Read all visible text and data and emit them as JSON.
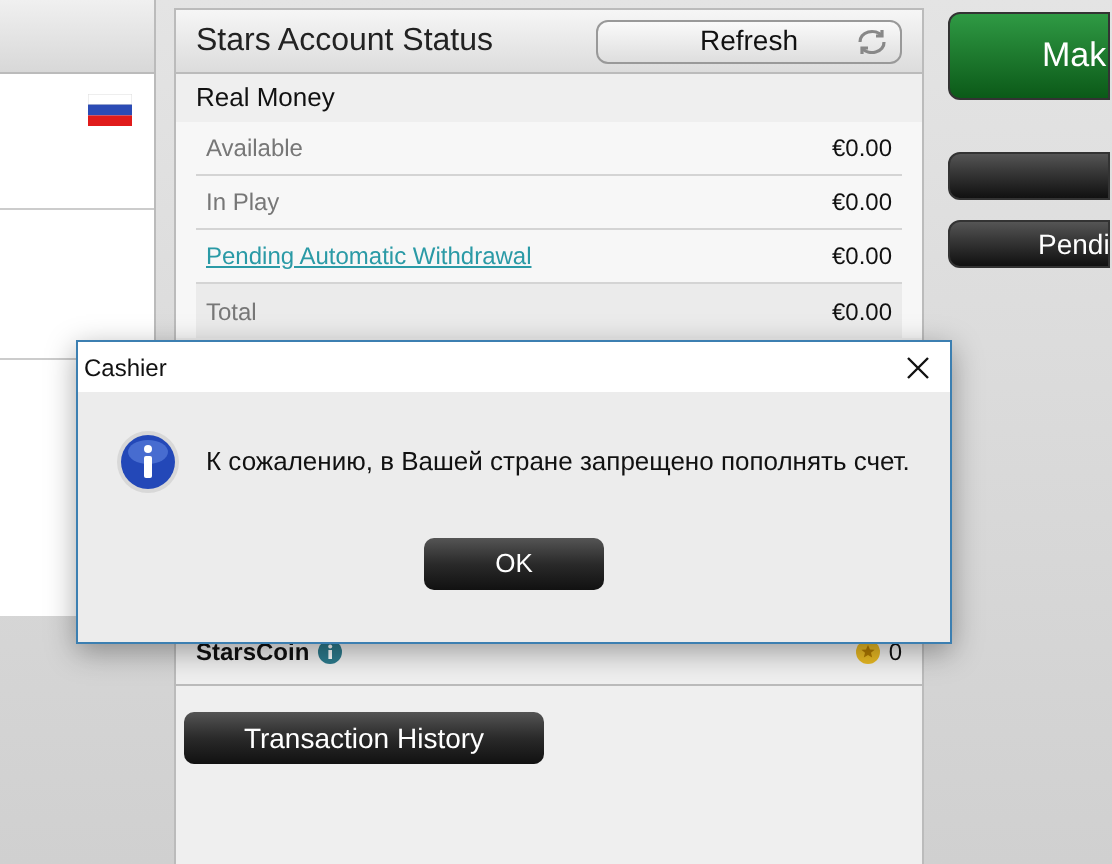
{
  "account_status": {
    "title": "Stars Account Status",
    "refresh_button": "Refresh",
    "section": "Real Money",
    "rows": [
      {
        "label": "Available",
        "value": "€0.00",
        "kind": "plain"
      },
      {
        "label": "In Play",
        "value": "€0.00",
        "kind": "plain"
      },
      {
        "label": "Pending Automatic Withdrawal",
        "value": "€0.00",
        "kind": "link"
      },
      {
        "label": "Total",
        "value": "€0.00",
        "kind": "plain"
      }
    ],
    "starscoin": {
      "label": "StarsCoin",
      "value": "0"
    },
    "history_button": "Transaction History"
  },
  "side_buttons": [
    {
      "label": "Mak",
      "kind": "primary"
    },
    {
      "kind": "dark"
    },
    {
      "label": "Pendi",
      "kind": "dark"
    }
  ],
  "dialog": {
    "title": "Cashier",
    "message": "К сожалению, в Вашей стране запрещено пополнять счет.",
    "button": "OK"
  }
}
